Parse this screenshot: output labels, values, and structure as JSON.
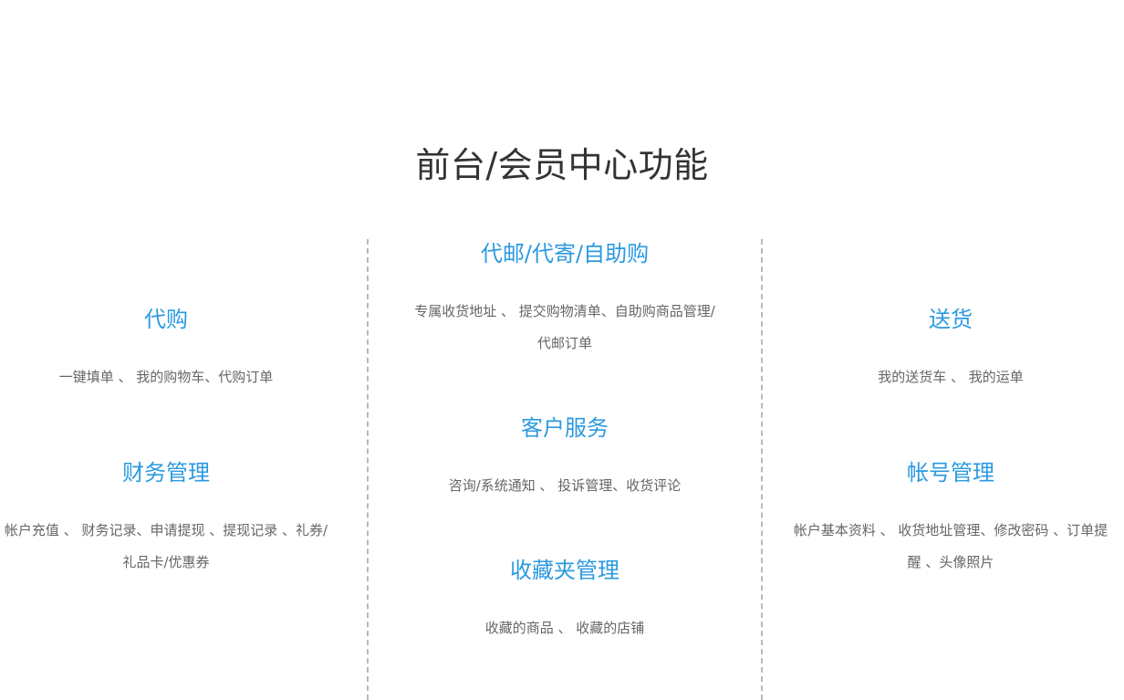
{
  "title": "前台/会员中心功能",
  "sections": {
    "daigou": {
      "title": "代购",
      "desc": "一键填单 、 我的购物车、代购订单"
    },
    "finance": {
      "title": "财务管理",
      "desc": "帐户充值 、 财务记录、申请提现 、提现记录 、礼券/礼品卡/优惠券"
    },
    "daiyou": {
      "title": "代邮/代寄/自助购",
      "desc": "专属收货地址 、 提交购物清单、自助购商品管理/代邮订单"
    },
    "service": {
      "title": "客户服务",
      "desc": "咨询/系统通知 、 投诉管理、收货评论"
    },
    "favorite": {
      "title": "收藏夹管理",
      "desc": "收藏的商品 、 收藏的店铺"
    },
    "delivery": {
      "title": "送货",
      "desc": "我的送货车 、 我的运单"
    },
    "account": {
      "title": "帐号管理",
      "desc": "帐户基本资料 、 收货地址管理、修改密码 、订单提醒 、头像照片"
    }
  },
  "colors": {
    "heading": "#2b9ae0",
    "text": "#666666",
    "title": "#333333",
    "divider": "#b9b9b9"
  }
}
